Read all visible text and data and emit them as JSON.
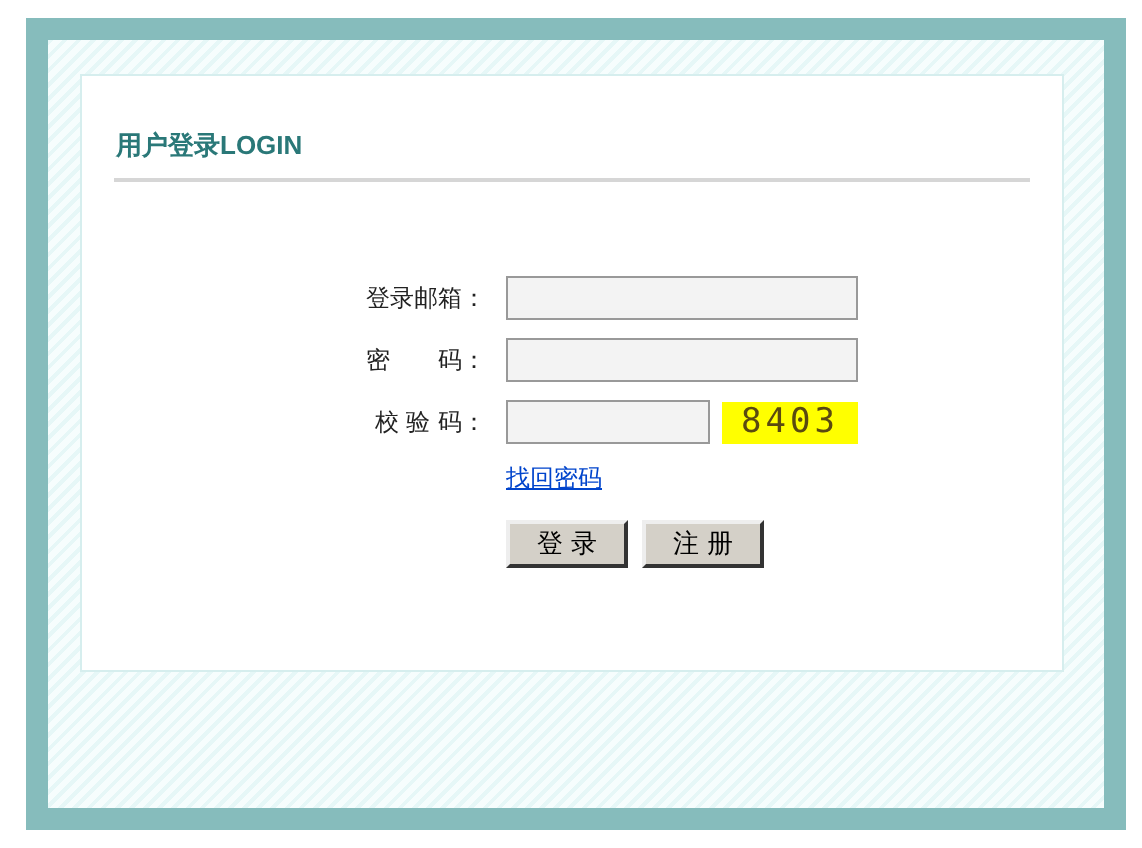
{
  "title": "用户登录LOGIN",
  "fields": [
    {
      "label": "登录邮箱：",
      "kind": "text"
    },
    {
      "label": "密　　码：",
      "kind": "password"
    },
    {
      "label": "校 验 码：",
      "kind": "captcha",
      "captcha": "8403"
    }
  ],
  "forgot_link": "找回密码",
  "buttons": [
    "登 录",
    "注 册"
  ]
}
